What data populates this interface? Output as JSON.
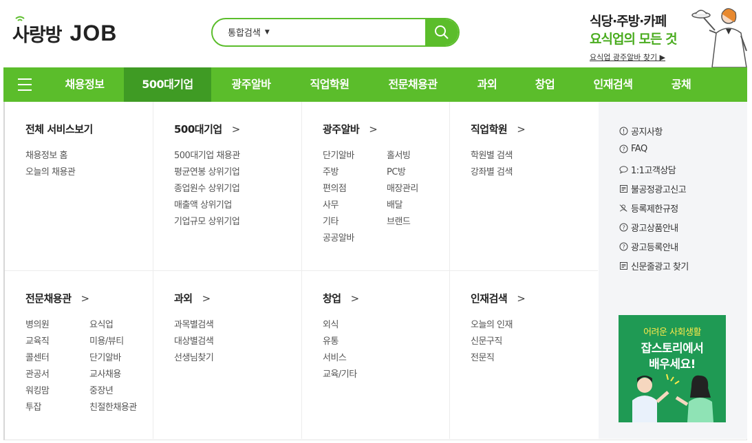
{
  "header": {
    "logo_ko": "사랑방",
    "logo_en": "JOB",
    "search": {
      "select_label": "통합검색",
      "placeholder": "",
      "value": ""
    },
    "promo": {
      "line1": "식당·주방·카페",
      "line2": "요식업의 모든 것",
      "link": "요식업 광주알바 찾기 ▶"
    }
  },
  "nav": {
    "items": [
      {
        "label": "채용정보"
      },
      {
        "label": "500대기업",
        "active": true
      },
      {
        "label": "광주알바"
      },
      {
        "label": "직업학원"
      },
      {
        "label": "전문채용관"
      },
      {
        "label": "과외"
      },
      {
        "label": "창업"
      },
      {
        "label": "인재검색"
      },
      {
        "label": "공채"
      }
    ]
  },
  "menu": {
    "all_services": {
      "title": "전체 서비스보기",
      "links": [
        "채용정보 홈",
        "오늘의 채용관"
      ]
    },
    "top500": {
      "title": "500대기업",
      "links": [
        "500대기업 채용관",
        "평균연봉 상위기업",
        "종업원수 상위기업",
        "매출액 상위기업",
        "기업규모 상위기업"
      ]
    },
    "alba": {
      "title": "광주알바",
      "col1": [
        "단기알바",
        "주방",
        "편의점",
        "사무",
        "기타",
        "공공알바"
      ],
      "col2": [
        "홀서빙",
        "PC방",
        "매장관리",
        "배달",
        "브랜드"
      ]
    },
    "academy": {
      "title": "직업학원",
      "links": [
        "학원별 검색",
        "강좌별 검색"
      ]
    },
    "specialist": {
      "title": "전문채용관",
      "col1": [
        "병의원",
        "교육직",
        "콜센터",
        "관공서",
        "워킹맘",
        "투잡"
      ],
      "col2": [
        "요식업",
        "미용/뷰티",
        "단기알바",
        "교사채용",
        "중장년",
        "친절한채용관"
      ]
    },
    "tutoring": {
      "title": "과외",
      "links": [
        "과목별검색",
        "대상별검색",
        "선생님찾기"
      ]
    },
    "startup": {
      "title": "창업",
      "links": [
        "외식",
        "유통",
        "서비스",
        "교육/기타"
      ]
    },
    "talent": {
      "title": "인재검색",
      "links": [
        "오늘의 인재",
        "신문구직",
        "전문직"
      ]
    }
  },
  "side": {
    "links": [
      {
        "label": "공지사항",
        "icon": "info-circle-icon"
      },
      {
        "label": "FAQ",
        "icon": "question-circle-icon"
      },
      {
        "label": "1:1고객상담",
        "icon": "chat-bubble-icon"
      },
      {
        "label": "불공정광고신고",
        "icon": "document-icon"
      },
      {
        "label": "등록제한규정",
        "icon": "user-blocked-icon"
      },
      {
        "label": "광고상품안내",
        "icon": "question-circle-icon"
      },
      {
        "label": "광고등록안내",
        "icon": "question-circle-icon"
      },
      {
        "label": "신문줄광고 찾기",
        "icon": "document-icon"
      }
    ],
    "banner": {
      "line1": "어려운 사회생활",
      "line2": "잡스토리에서",
      "line3": "배우세요!"
    }
  },
  "colors": {
    "brand_green": "#5bbd2b",
    "nav_active": "#3f9b24",
    "banner_green": "#1f9a54"
  }
}
